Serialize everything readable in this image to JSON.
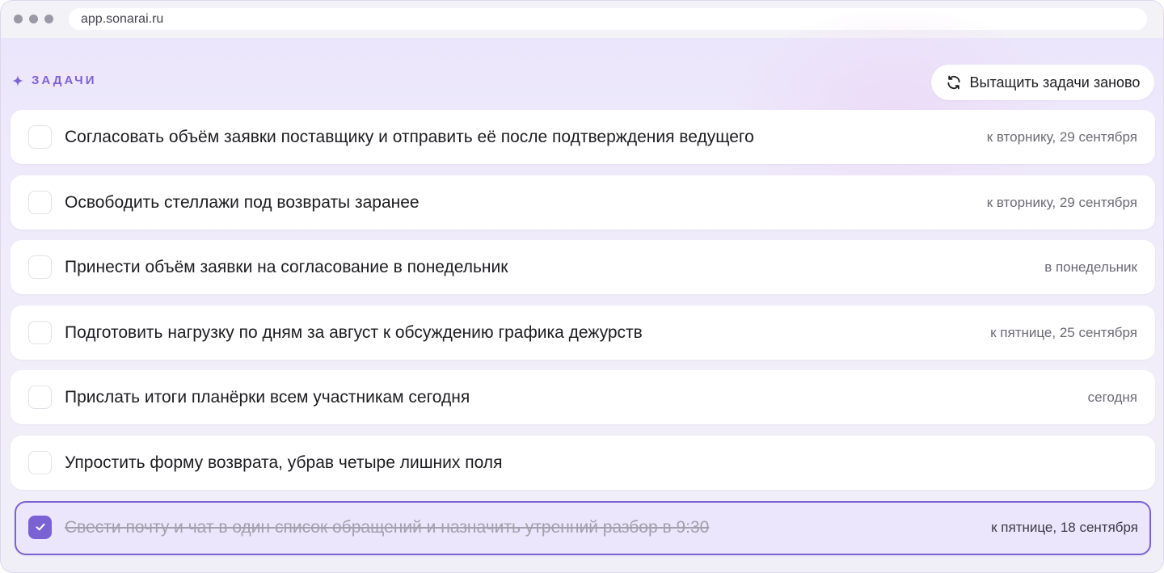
{
  "browser": {
    "url": "app.sonarai.ru"
  },
  "section": {
    "title": "ЗАДАЧИ",
    "icon": "sparkle-icon",
    "refresh_label": "Вытащить задачи заново",
    "refresh_icon": "refresh-icon"
  },
  "colors": {
    "accent": "#7a62d4",
    "background": "#eee9fb"
  },
  "tasks": [
    {
      "text": "Согласовать объём заявки поставщику и отправить её после подтверждения ведущего",
      "due": "к вторнику, 29 сентября",
      "done": false
    },
    {
      "text": "Освободить стеллажи под возвраты заранее",
      "due": "к вторнику, 29 сентября",
      "done": false
    },
    {
      "text": "Принести объём заявки на согласование в понедельник",
      "due": "в понедельник",
      "done": false
    },
    {
      "text": "Подготовить нагрузку по дням за август к обсуждению графика дежурств",
      "due": "к пятнице, 25 сентября",
      "done": false
    },
    {
      "text": "Прислать итоги планёрки всем участникам сегодня",
      "due": "сегодня",
      "done": false
    },
    {
      "text": "Упростить форму возврата, убрав четыре лишних поля",
      "due": "",
      "done": false
    },
    {
      "text": "Свести почту и чат в один список обращений и назначить утренний разбор в 9:30",
      "due": "к пятнице, 18 сентября",
      "done": true
    }
  ]
}
